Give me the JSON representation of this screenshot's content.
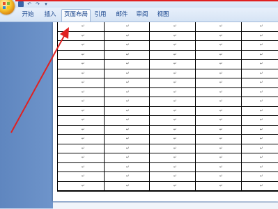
{
  "window": {
    "quick_access": {
      "save_icon": "save-icon",
      "undo_label": "↶",
      "redo_label": "↷",
      "customize_label": "▾"
    }
  },
  "ribbon": {
    "tabs": [
      {
        "label": "开始"
      },
      {
        "label": "插入"
      },
      {
        "label": "页面布局"
      },
      {
        "label": "引用"
      },
      {
        "label": "邮件"
      },
      {
        "label": "审阅"
      },
      {
        "label": "视图"
      }
    ],
    "active_tab": "页面布局"
  },
  "document": {
    "table": {
      "rows": 18,
      "columns": 5,
      "cell_mark": "↵"
    }
  },
  "colors": {
    "annotation": "#e02020",
    "ribbon_text": "#15428b",
    "workspace": "#6f95cb"
  },
  "annotations": [
    {
      "type": "arrow",
      "points_to": "tab-page-layout"
    },
    {
      "type": "line",
      "color": "#e02020"
    }
  ]
}
